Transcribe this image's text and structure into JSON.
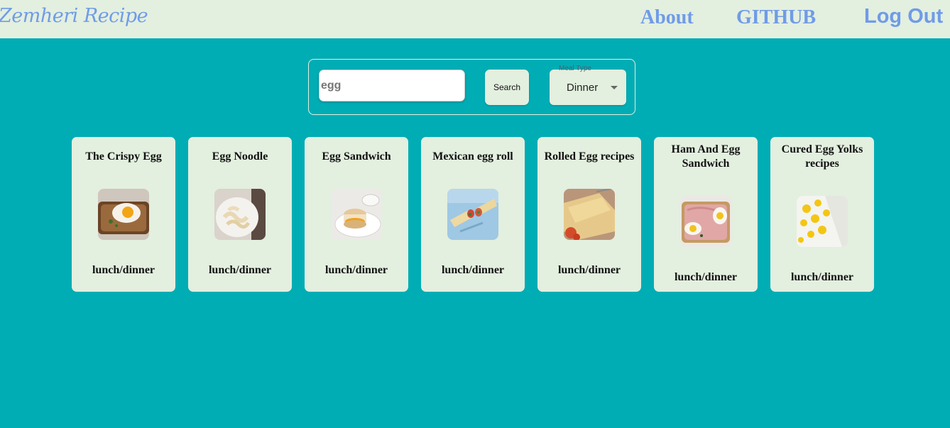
{
  "header": {
    "brand": "Zemheri Recipe",
    "nav": {
      "about": "About",
      "github": "GITHUB",
      "logout": "Log Out"
    }
  },
  "search": {
    "value": "egg",
    "button_label": "Search",
    "meal_type_label": "Meal Type",
    "meal_type_value": "Dinner"
  },
  "colors": {
    "background": "#00adb5",
    "panel": "#e3efdf",
    "link": "#6f9be8"
  },
  "recipes": [
    {
      "title": "The Crispy Egg",
      "type": "lunch/dinner",
      "image": "fried-egg-toast-photo"
    },
    {
      "title": "Egg Noodle",
      "type": "lunch/dinner",
      "image": "egg-noodle-plate-photo"
    },
    {
      "title": "Egg Sandwich",
      "type": "lunch/dinner",
      "image": "egg-muffin-sandwich-photo"
    },
    {
      "title": "Mexican egg roll",
      "type": "lunch/dinner",
      "image": "egg-roll-wrap-photo"
    },
    {
      "title": "Rolled Egg recipes",
      "type": "lunch/dinner",
      "image": "rolled-omelette-photo"
    },
    {
      "title": "Ham And Egg Sandwich",
      "type": "lunch/dinner",
      "image": "ham-egg-toast-photo"
    },
    {
      "title": "Cured Egg Yolks recipes",
      "type": "lunch/dinner",
      "image": "cured-yolks-photo"
    }
  ]
}
